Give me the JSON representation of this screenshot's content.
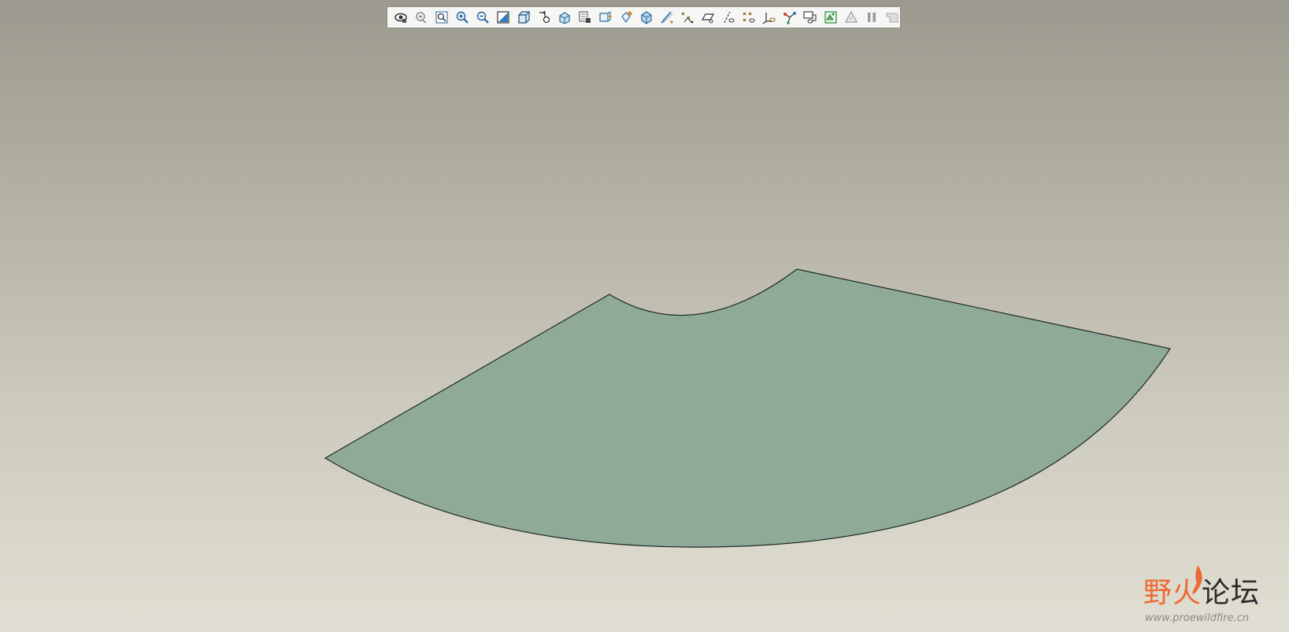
{
  "window": {
    "title": "",
    "background_top": "#9c9a8e",
    "background_bottom": "#e1dfd3"
  },
  "toolbar": {
    "buttons": [
      {
        "icon": "saved-view-icon"
      },
      {
        "icon": "orient-view-icon"
      },
      {
        "icon": "refit-icon"
      },
      {
        "icon": "zoom-in-icon"
      },
      {
        "icon": "zoom-out-icon"
      },
      {
        "icon": "repaint-icon"
      },
      {
        "icon": "shading-icon"
      },
      {
        "icon": "view-manager-icon"
      },
      {
        "icon": "saved-orientations-icon"
      },
      {
        "icon": "layers-icon"
      },
      {
        "icon": "datum-plane-icon"
      },
      {
        "icon": "datum-axis-icon"
      },
      {
        "icon": "datum-point-icon"
      },
      {
        "icon": "coordinate-system-icon"
      },
      {
        "icon": "sketch-icon"
      },
      {
        "icon": "datum-plane-display-icon"
      },
      {
        "icon": "datum-axis-display-icon"
      },
      {
        "icon": "datum-point-display-icon"
      },
      {
        "icon": "csys-display-icon"
      },
      {
        "icon": "annotation-display-icon"
      },
      {
        "icon": "model-tree-icon"
      },
      {
        "icon": "appearance-icon"
      },
      {
        "icon": "regenerate-icon"
      },
      {
        "icon": "pause-icon"
      },
      {
        "icon": "flag-icon"
      }
    ]
  },
  "model": {
    "fill_color": "#8faa98",
    "edge_color": "#1f2a24",
    "shape": "annular-sector-sheet"
  },
  "watermark": {
    "title_part1": "野火",
    "title_part2": "论坛",
    "url": "www.proewildfire.cn",
    "accent_color": "#ee6a34"
  }
}
